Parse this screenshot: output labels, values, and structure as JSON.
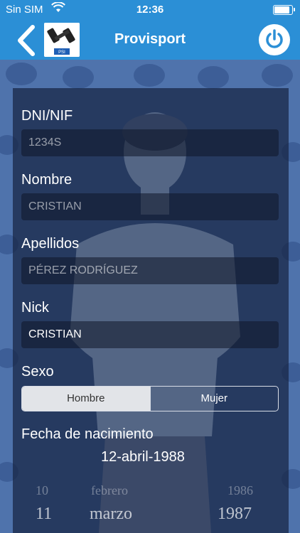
{
  "status_bar": {
    "carrier": "Sin SIM",
    "time": "12:36",
    "battery_level": 0.95
  },
  "navbar": {
    "title": "Provisport",
    "logo_text": "PSI"
  },
  "form": {
    "dni": {
      "label": "DNI/NIF",
      "value": "1234S"
    },
    "nombre": {
      "label": "Nombre",
      "value": "CRISTIAN"
    },
    "apellidos": {
      "label": "Apellidos",
      "value": "PÉREZ RODRÍGUEZ"
    },
    "nick": {
      "label": "Nick",
      "value": "CRISTIAN"
    },
    "sexo": {
      "label": "Sexo",
      "options": [
        "Hombre",
        "Mujer"
      ],
      "selected": "Hombre"
    },
    "fecha": {
      "label": "Fecha de nacimiento",
      "value": "12-abril-1988"
    }
  },
  "date_picker": {
    "rows": [
      {
        "day": "10",
        "month": "febrero",
        "year": "1986"
      },
      {
        "day": "11",
        "month": "marzo",
        "year": "1987"
      }
    ]
  },
  "colors": {
    "navbar": "#2b8fd6",
    "accent": "#2b8fd6"
  }
}
